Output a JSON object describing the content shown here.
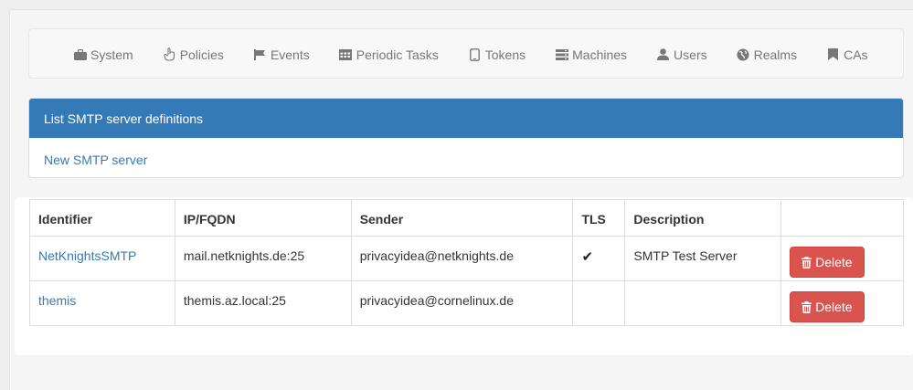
{
  "nav": {
    "items": [
      {
        "label": "System",
        "icon": "briefcase-icon"
      },
      {
        "label": "Policies",
        "icon": "hand-icon"
      },
      {
        "label": "Events",
        "icon": "flag-icon"
      },
      {
        "label": "Periodic Tasks",
        "icon": "calendar-icon"
      },
      {
        "label": "Tokens",
        "icon": "phone-icon"
      },
      {
        "label": "Machines",
        "icon": "server-icon"
      },
      {
        "label": "Users",
        "icon": "user-icon"
      },
      {
        "label": "Realms",
        "icon": "globe-icon"
      },
      {
        "label": "CAs",
        "icon": "bookmark-icon"
      }
    ]
  },
  "panel": {
    "heading": "List SMTP server definitions",
    "new_link": "New SMTP server"
  },
  "table": {
    "headers": [
      "Identifier",
      "IP/FQDN",
      "Sender",
      "TLS",
      "Description",
      ""
    ],
    "rows": [
      {
        "identifier": "NetKnightsSMTP",
        "ip": "mail.netknights.de:25",
        "sender": "privacyidea@netknights.de",
        "tls": "✔",
        "description": "SMTP Test Server",
        "action": "Delete"
      },
      {
        "identifier": "themis",
        "ip": "themis.az.local:25",
        "sender": "privacyidea@cornelinux.de",
        "tls": "",
        "description": "",
        "action": "Delete"
      }
    ]
  },
  "colors": {
    "primary": "#337ab7",
    "danger": "#d9534f",
    "nav_text": "#777777"
  }
}
